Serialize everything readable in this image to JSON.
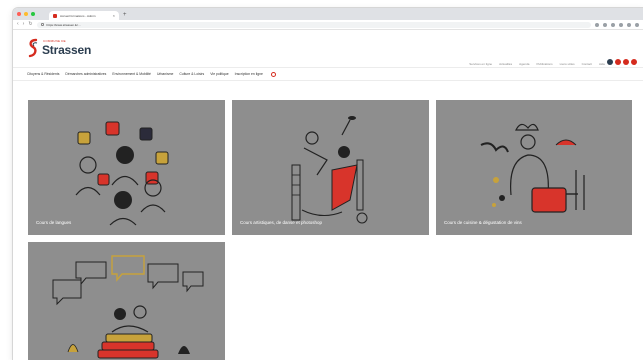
{
  "browser": {
    "tab_title": "Accueil formations - Admin",
    "url": "https://www.strassen.lu/...",
    "traffic_lights": [
      "#ff5f57",
      "#febc2e",
      "#28c840"
    ]
  },
  "site": {
    "logo_small": "COMMUNE DE",
    "logo_name": "Strassen",
    "brand_color": "#d52b1e",
    "top_links": [
      "Services en ligne",
      "Actualités",
      "Agenda",
      "Publications",
      "Liens utiles",
      "Contact",
      "Aide"
    ],
    "social_colors": [
      "#2c3e50",
      "#d52b1e",
      "#d52b1e",
      "#d52b1e"
    ],
    "nav": [
      "Citoyens & Résidents",
      "Démarches administratives",
      "Environnement & Mobilité",
      "Urbanisme",
      "Culture & Loisirs",
      "Vie politique",
      "Inscription en ligne"
    ]
  },
  "cards": [
    {
      "label": "Cours de langues",
      "icon": "languages-illustration"
    },
    {
      "label": "Cours artistiques, de danse et photoshop",
      "icon": "arts-dance-illustration"
    },
    {
      "label": "Cours de cuisine & dégustation de vins",
      "icon": "cooking-illustration"
    },
    {
      "label": "",
      "icon": "reading-illustration"
    }
  ]
}
